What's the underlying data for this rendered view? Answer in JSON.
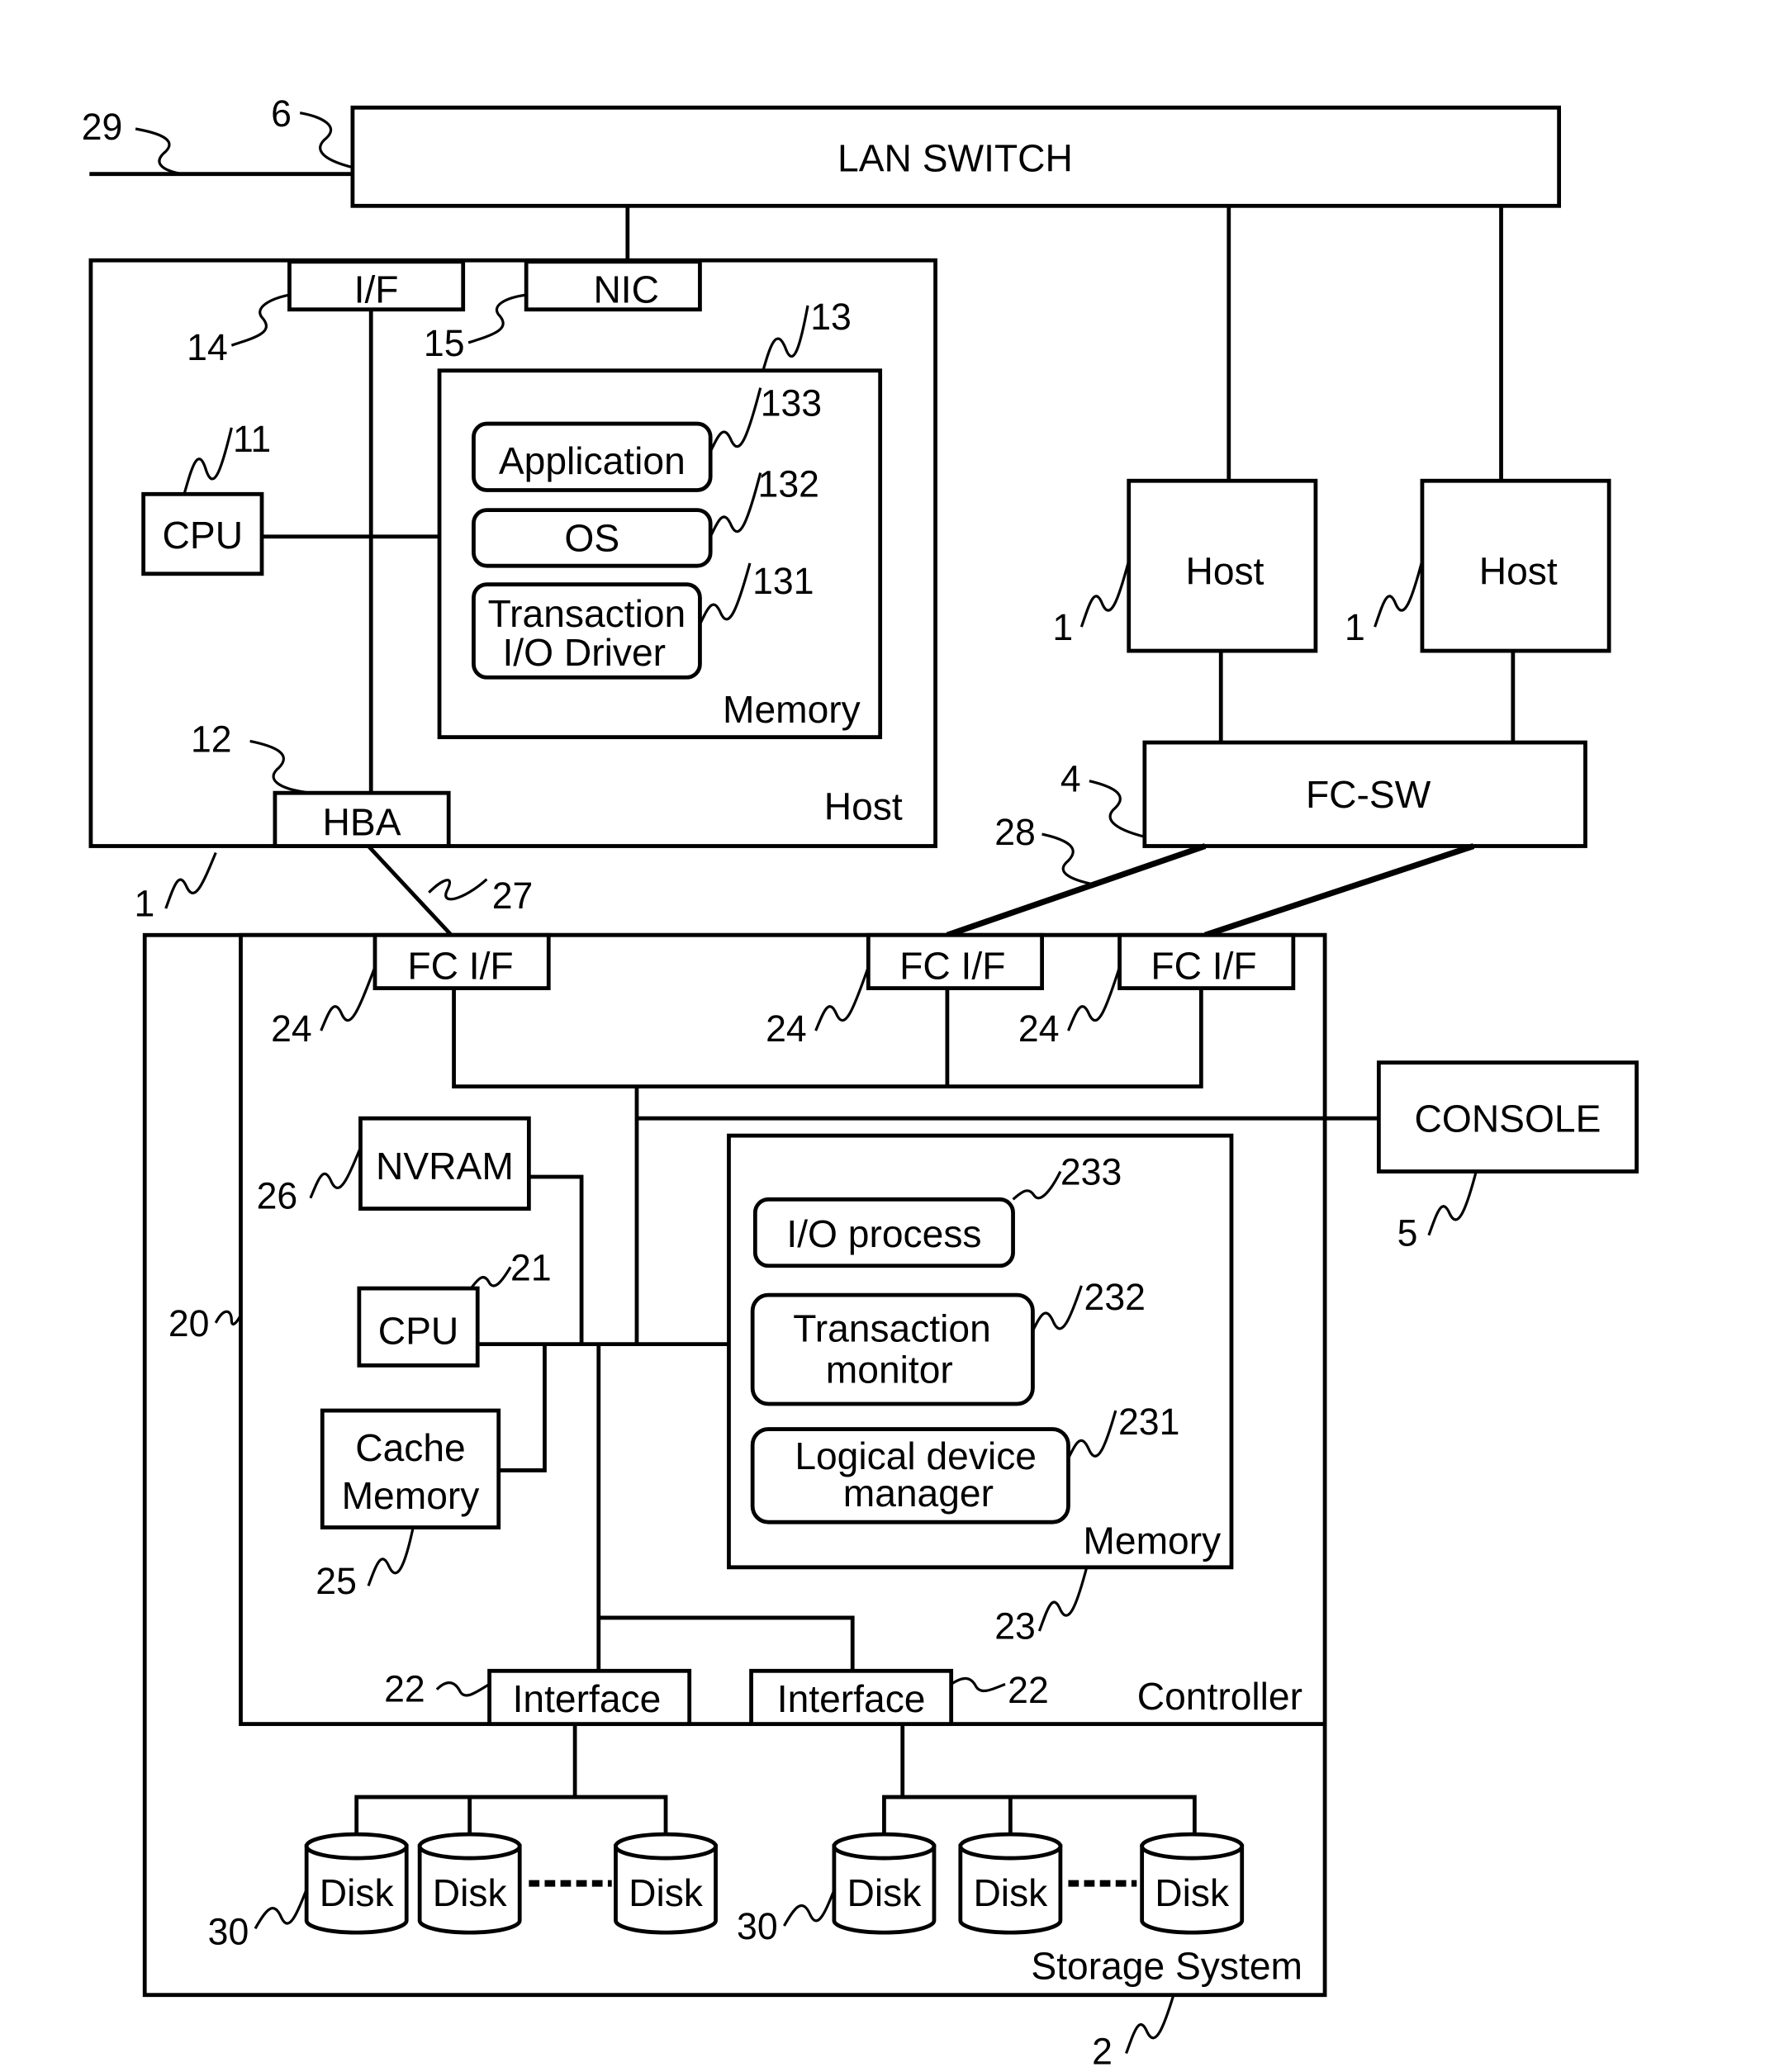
{
  "diagram": {
    "type": "storage-system-block-diagram",
    "lan_switch": {
      "label": "LAN SWITCH",
      "ref": "6",
      "external_link_ref": "29"
    },
    "host_main": {
      "label": "Host",
      "ref": "1",
      "if": {
        "label": "I/F",
        "ref": "14"
      },
      "nic": {
        "label": "NIC",
        "ref": "15"
      },
      "cpu": {
        "label": "CPU",
        "ref": "11"
      },
      "hba": {
        "label": "HBA",
        "ref": "12"
      },
      "memory": {
        "label": "Memory",
        "ref": "13",
        "items": [
          {
            "label": "Application",
            "ref": "133"
          },
          {
            "label": "OS",
            "ref": "132"
          },
          {
            "label_line1": "Transaction",
            "label_line2": "I/O Driver",
            "ref": "131"
          }
        ]
      }
    },
    "hosts_other": [
      {
        "label": "Host",
        "ref": "1"
      },
      {
        "label": "Host",
        "ref": "1"
      }
    ],
    "fc_switch": {
      "label": "FC-SW",
      "ref": "4",
      "link_ref": "28"
    },
    "hba_link_ref": "27",
    "console": {
      "label": "CONSOLE",
      "ref": "5"
    },
    "storage_system": {
      "label": "Storage System",
      "ref": "2",
      "controller": {
        "label": "Controller",
        "ref": "20",
        "fc_ifs": [
          {
            "label": "FC I/F",
            "ref": "24"
          },
          {
            "label": "FC I/F",
            "ref": "24"
          },
          {
            "label": "FC I/F",
            "ref": "24"
          }
        ],
        "nvram": {
          "label": "NVRAM",
          "ref": "26"
        },
        "cpu": {
          "label": "CPU",
          "ref": "21"
        },
        "cache": {
          "label_line1": "Cache",
          "label_line2": "Memory",
          "ref": "25"
        },
        "memory": {
          "label": "Memory",
          "ref": "23",
          "items": [
            {
              "label": "I/O process",
              "ref": "233"
            },
            {
              "label_line1": "Transaction",
              "label_line2": "monitor",
              "ref": "232"
            },
            {
              "label_line1": "Logical device",
              "label_line2": "manager",
              "ref": "231"
            }
          ]
        },
        "interfaces": [
          {
            "label": "Interface",
            "ref": "22"
          },
          {
            "label": "Interface",
            "ref": "22"
          }
        ]
      },
      "disk_groups": [
        {
          "ref": "30",
          "disks": [
            "Disk",
            "Disk",
            "Disk"
          ]
        },
        {
          "ref": "30",
          "disks": [
            "Disk",
            "Disk",
            "Disk"
          ]
        }
      ]
    }
  }
}
